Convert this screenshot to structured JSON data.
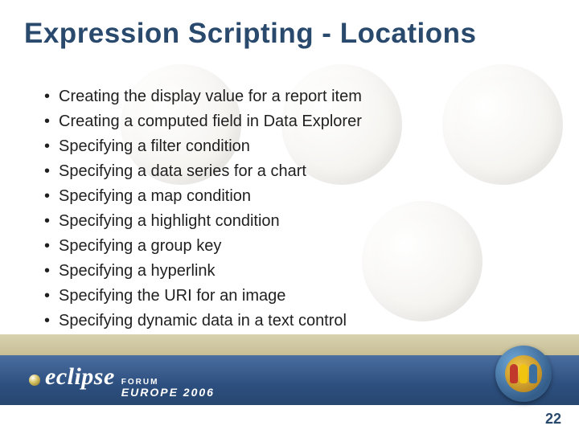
{
  "title": "Expression Scripting - Locations",
  "bullets": [
    "Creating the display value for a report item",
    "Creating a computed field in Data Explorer",
    "Specifying a filter condition",
    "Specifying a data series for a chart",
    "Specifying a map condition",
    "Specifying a highlight condition",
    "Specifying a group key",
    "Specifying a hyperlink",
    "Specifying the URI for an image",
    "Specifying dynamic data in a text control"
  ],
  "logo": {
    "word": "eclipse",
    "forum": "FORUM",
    "europe": "EUROPE 2006"
  },
  "page_number": "22"
}
